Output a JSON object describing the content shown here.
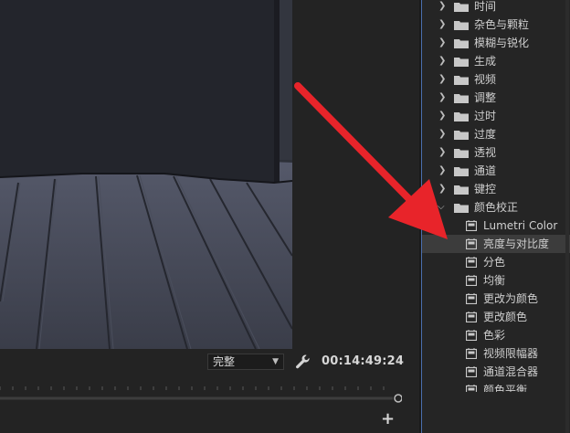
{
  "monitor": {
    "quality": {
      "value": "完整"
    },
    "timecode": "00:14:49:24"
  },
  "effects_panel": {
    "folders": [
      {
        "label": "时间"
      },
      {
        "label": "杂色与颗粒"
      },
      {
        "label": "模糊与锐化"
      },
      {
        "label": "生成"
      },
      {
        "label": "视频"
      },
      {
        "label": "调整"
      },
      {
        "label": "过时"
      },
      {
        "label": "过度"
      },
      {
        "label": "透视"
      },
      {
        "label": "通道"
      },
      {
        "label": "键控"
      },
      {
        "label": "颜色校正"
      }
    ],
    "color_correction_items": [
      {
        "label": "Lumetri Color"
      },
      {
        "label": "亮度与对比度"
      },
      {
        "label": "分色"
      },
      {
        "label": "均衡"
      },
      {
        "label": "更改为颜色"
      },
      {
        "label": "更改颜色"
      },
      {
        "label": "色彩"
      },
      {
        "label": "视频限幅器"
      },
      {
        "label": "通道混合器"
      },
      {
        "label": "颜色平衡"
      }
    ],
    "selected_item": "亮度与对比度"
  },
  "colors": {
    "panel_bg": "#252525",
    "selection": "#3c3c3c",
    "annotation_arrow": "#e8242a"
  }
}
